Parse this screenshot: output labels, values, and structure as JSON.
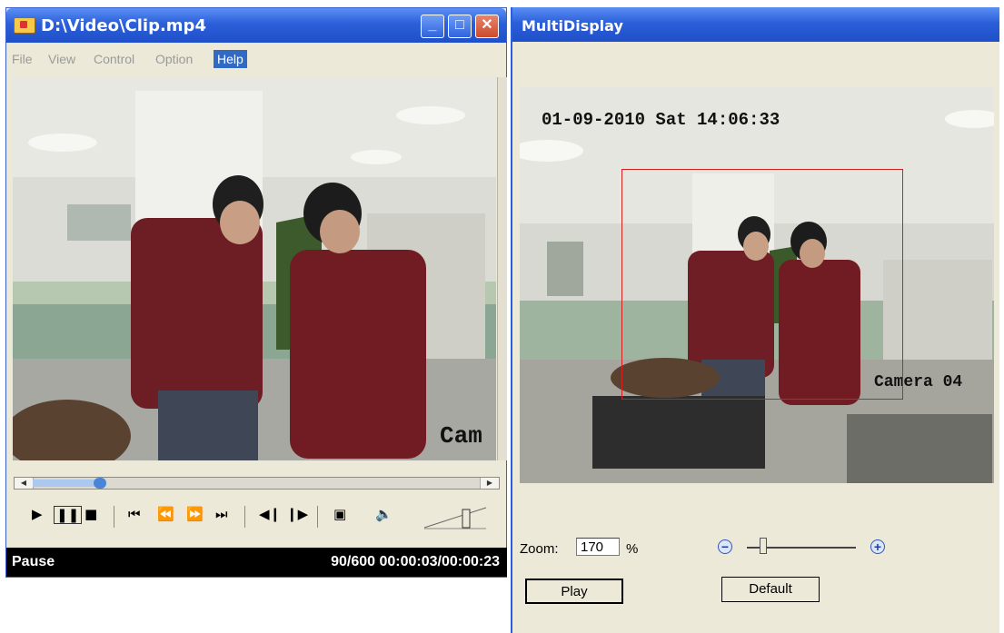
{
  "player": {
    "title": "D:\\Video\\Clip.mp4",
    "window_buttons": {
      "minimize": "_",
      "maximize": "□",
      "close": "✕"
    },
    "menu": [
      "File",
      "View",
      "Control",
      "Option",
      "Help"
    ],
    "active_menu": "Help",
    "overlay_text": "Cam",
    "seek_progress": 0.15,
    "status": {
      "state": "Pause",
      "position": "90/600 00:00:03/00:00:23"
    }
  },
  "multi": {
    "title": "MultiDisplay",
    "osd_datetime": "01-09-2010 Sat 14:06:33",
    "osd_camera": "Camera 04",
    "zoom_label": "Zoom:",
    "zoom_value": "170",
    "zoom_unit": "%",
    "play_label": "Play",
    "default_label": "Default"
  },
  "colors": {
    "titlebar": "#2b5fd9",
    "roi": "#d21f1f",
    "status_bg": "#000000"
  }
}
